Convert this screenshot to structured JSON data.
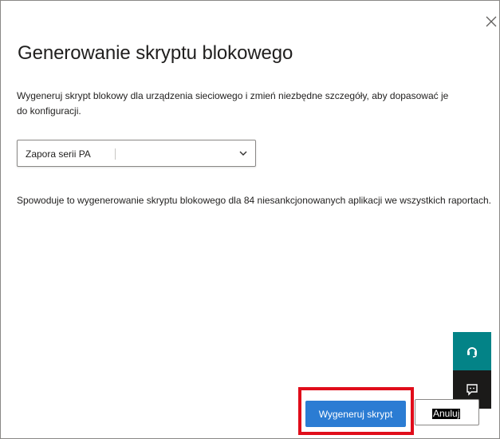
{
  "dialog": {
    "title": "Generowanie skryptu blokowego",
    "description": "Wygeneruj skrypt blokowy dla urządzenia sieciowego i zmień niezbędne szczegóły, aby dopasować je do konfiguracji.",
    "close_icon": "close-icon"
  },
  "dropdown": {
    "selected": "Zapora serii PA",
    "chevron_icon": "chevron-down-icon"
  },
  "info_text": "Spowoduje to wygenerowanie skryptu blokowego dla 84 niesankcjonowanych aplikacji we wszystkich raportach.",
  "side_panel": {
    "support_icon": "headset-icon",
    "feedback_icon": "feedback-icon"
  },
  "buttons": {
    "generate_label": "Wygeneruj skrypt",
    "cancel_label": "Anuluj"
  },
  "colors": {
    "primary": "#2b7cd3",
    "highlight": "#e00d1a",
    "teal": "#038387",
    "dark": "#1b1a19"
  }
}
